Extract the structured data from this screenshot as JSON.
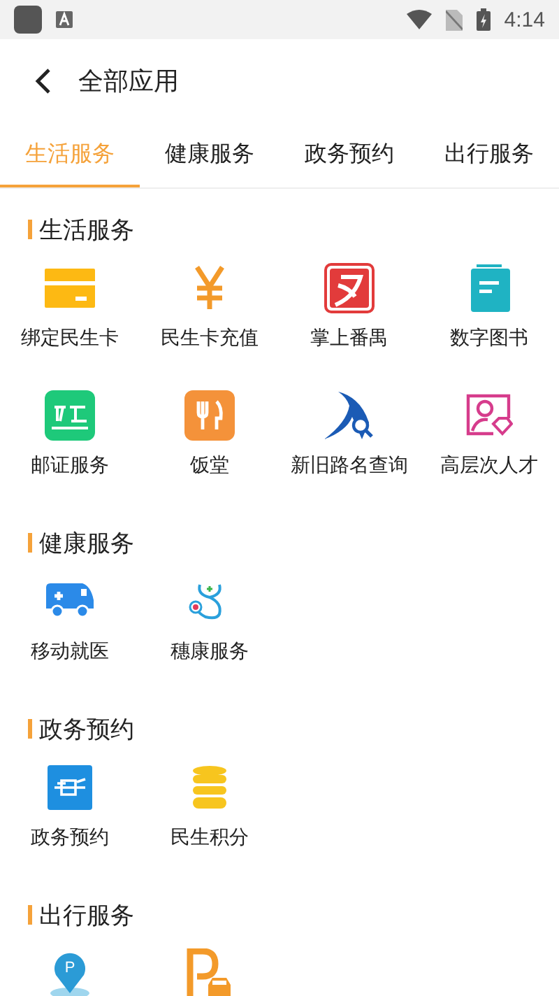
{
  "status_bar": {
    "time": "4:14"
  },
  "header": {
    "title": "全部应用"
  },
  "tabs": [
    {
      "label": "生活服务",
      "selected": true
    },
    {
      "label": "健康服务",
      "selected": false
    },
    {
      "label": "政务预约",
      "selected": false
    },
    {
      "label": "出行服务",
      "selected": false
    }
  ],
  "sections": [
    {
      "title": "生活服务",
      "items": [
        {
          "label": "绑定民生卡",
          "kind": "card"
        },
        {
          "label": "民生卡充值",
          "kind": "yen"
        },
        {
          "label": "掌上番禺",
          "kind": "panyu"
        },
        {
          "label": "数字图书",
          "kind": "book"
        },
        {
          "label": "邮证服务",
          "kind": "postal"
        },
        {
          "label": "饭堂",
          "kind": "dining"
        },
        {
          "label": "新旧路名查询",
          "kind": "road"
        },
        {
          "label": "高层次人才",
          "kind": "talent"
        }
      ]
    },
    {
      "title": "健康服务",
      "items": [
        {
          "label": "移动就医",
          "kind": "ambulance"
        },
        {
          "label": "穗康服务",
          "kind": "stethoscope"
        }
      ]
    },
    {
      "title": "政务预约",
      "items": [
        {
          "label": "政务预约",
          "kind": "gov"
        },
        {
          "label": "民生积分",
          "kind": "coins"
        }
      ]
    },
    {
      "title": "出行服务",
      "items": [
        {
          "kind": "parking-pin",
          "sign": "P"
        },
        {
          "kind": "parking-car"
        }
      ]
    }
  ]
}
